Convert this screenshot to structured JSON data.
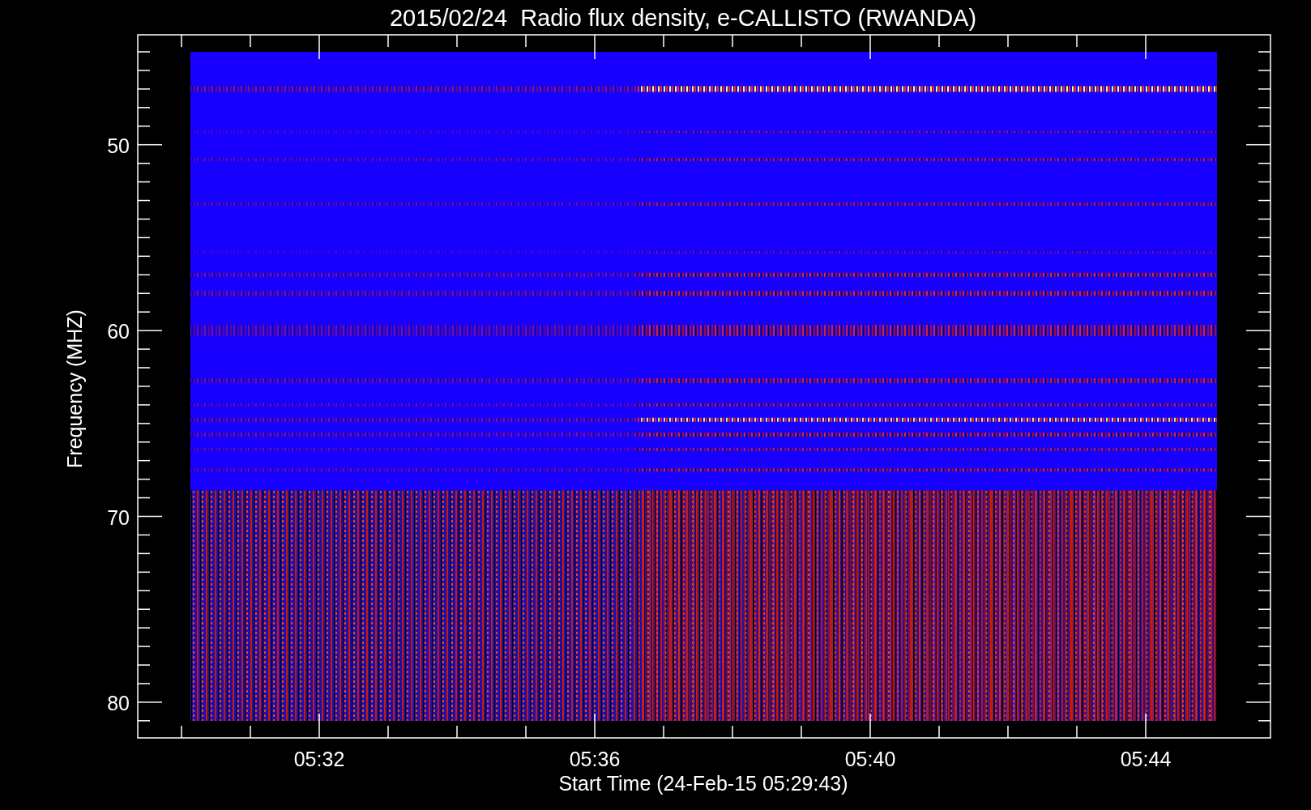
{
  "title": "2015/02/24  Radio flux density, e-CALLISTO (RWANDA)",
  "y_axis": {
    "label": "Frequency (MHZ)",
    "ticks": [
      "50",
      "60",
      "70",
      "80"
    ]
  },
  "x_axis": {
    "label": "Start Time (24-Feb-15 05:29:43)",
    "ticks": [
      "05:32",
      "05:36",
      "05:40",
      "05:44"
    ]
  }
}
